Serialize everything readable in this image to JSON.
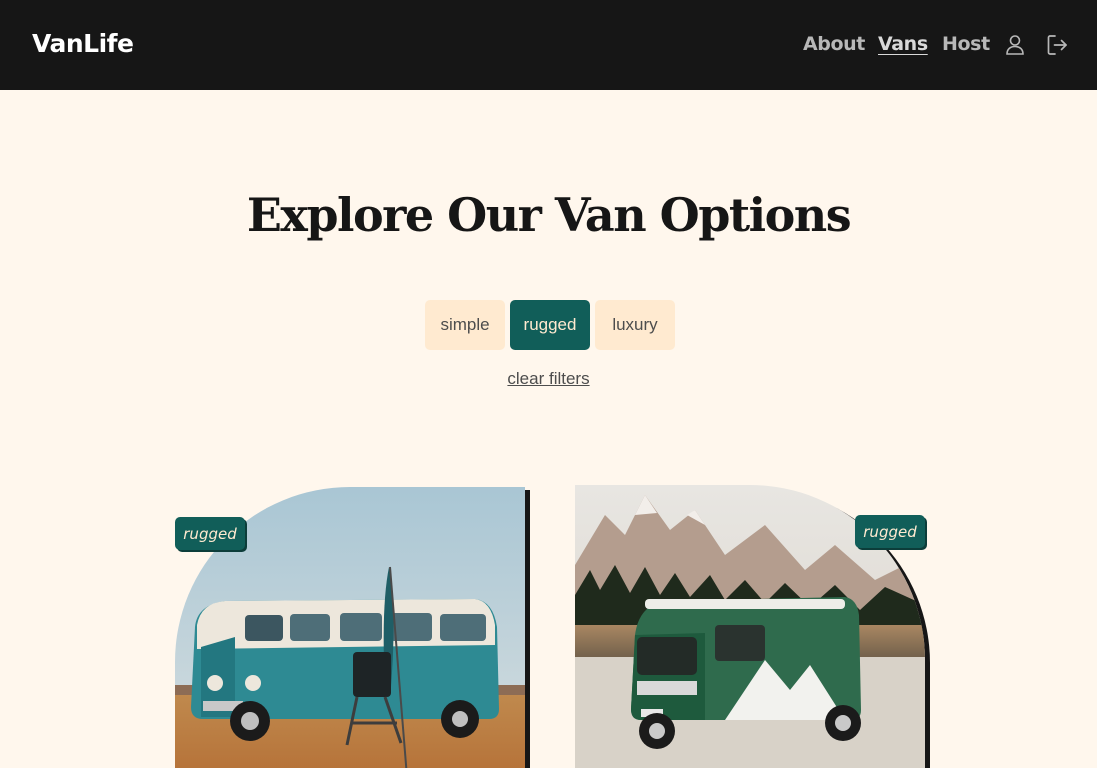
{
  "header": {
    "logo": "VanLife",
    "nav": [
      {
        "label": "About"
      },
      {
        "label": "Vans",
        "active": true
      },
      {
        "label": "Host"
      }
    ],
    "icons": [
      "user-icon",
      "logout-icon"
    ]
  },
  "main": {
    "title": "Explore Our Van Options",
    "filters": [
      {
        "label": "simple",
        "selected": false
      },
      {
        "label": "rugged",
        "selected": true
      },
      {
        "label": "luxury",
        "selected": false
      }
    ],
    "clear_filters": "clear filters"
  },
  "vans": [
    {
      "type": "rugged",
      "image": "teal-and-white-camper-van-on-beach"
    },
    {
      "type": "rugged",
      "image": "green-camper-van-by-mountain-lake"
    }
  ],
  "colors": {
    "header_bg": "#161616",
    "page_bg": "#FFF7ED",
    "accent": "#115E59",
    "filter_bg": "#FFEAD0"
  }
}
